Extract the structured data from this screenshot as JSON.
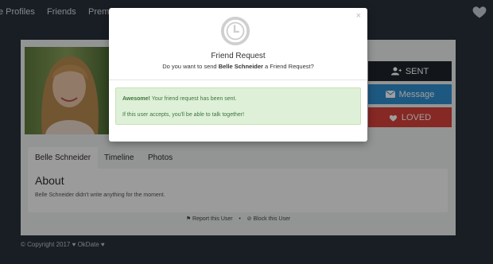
{
  "nav": {
    "items": [
      "e Profiles",
      "Friends",
      "Prem"
    ]
  },
  "profile": {
    "name": "Belle Schneider",
    "buttons": {
      "sent": "SENT",
      "message": "Message",
      "loved": "LOVED"
    },
    "tabs": [
      "Belle Schneider",
      "Timeline",
      "Photos"
    ],
    "about_title": "About",
    "about_text": "Belle Schneider didn't write anything for the moment.",
    "report": "Report this User",
    "separator": "•",
    "block": "Block this User"
  },
  "footer": "© Copyright 2017 ♥ OkDate ♥",
  "modal": {
    "close": "×",
    "title": "Friend Request",
    "question_prefix": "Do you want to send ",
    "question_name": "Belle Schneider",
    "question_suffix": " a Friend Request?",
    "alert_strong": "Awesome!",
    "alert_text": " Your friend request has been sent.",
    "alert_line2": "If this user accepts, you'll be able to talk together!"
  },
  "colors": {
    "background": "#27313a",
    "sent": "#1e252b",
    "message": "#2f8fd0",
    "loved": "#d9423b",
    "alert_bg": "#dff0d8",
    "alert_text": "#3c763d"
  },
  "icons": [
    "heart-icon",
    "user-plus-icon",
    "envelope-icon",
    "flag-icon",
    "block-icon",
    "clock-icon",
    "close-icon"
  ]
}
